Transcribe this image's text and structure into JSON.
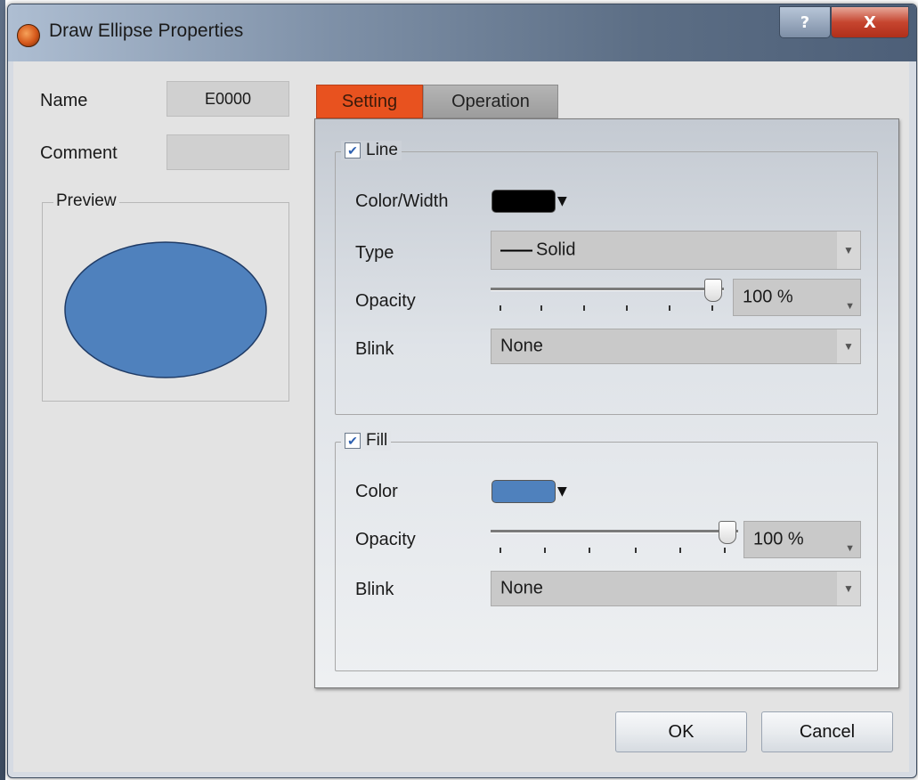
{
  "window": {
    "title": "Draw Ellipse Properties",
    "help_label": "?",
    "close_label": "X"
  },
  "left": {
    "name_label": "Name",
    "name_value": "E0000",
    "comment_label": "Comment",
    "comment_value": "",
    "preview_label": "Preview",
    "preview_ellipse_fill": "#4f81bd",
    "preview_ellipse_stroke": "#1f3b66"
  },
  "tabs": [
    {
      "label": "Setting",
      "active": true
    },
    {
      "label": "Operation",
      "active": false
    }
  ],
  "line": {
    "enabled": true,
    "title": "Line",
    "color_width_label": "Color/Width",
    "color": "#000000",
    "type_label": "Type",
    "type_value": "Solid",
    "opacity_label": "Opacity",
    "opacity_value": "100 %",
    "opacity_fraction": 1.0,
    "blink_label": "Blink",
    "blink_value": "None"
  },
  "fill": {
    "enabled": true,
    "title": "Fill",
    "color_label": "Color",
    "color": "#4f81bd",
    "opacity_label": "Opacity",
    "opacity_value": "100 %",
    "opacity_fraction": 1.0,
    "blink_label": "Blink",
    "blink_value": "None"
  },
  "buttons": {
    "ok_label": "OK",
    "cancel_label": "Cancel"
  }
}
